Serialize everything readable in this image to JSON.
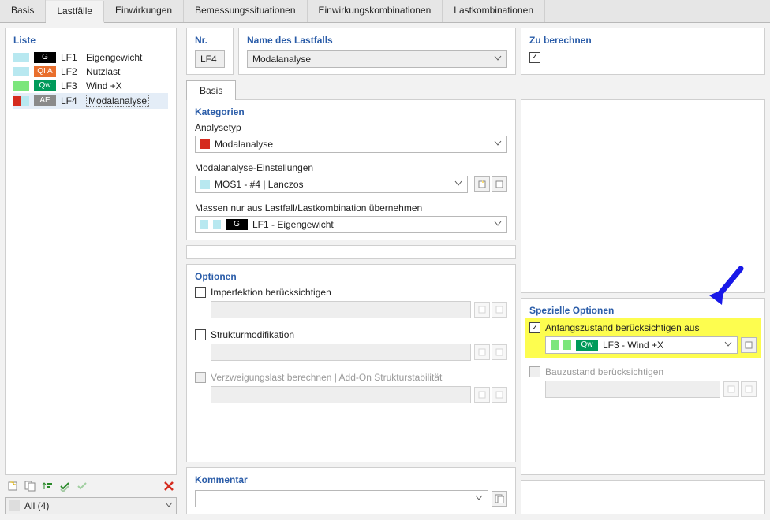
{
  "topTabs": {
    "items": [
      "Basis",
      "Lastfälle",
      "Einwirkungen",
      "Bemessungssituationen",
      "Einwirkungskombinationen",
      "Lastkombinationen"
    ],
    "activeIndex": 1
  },
  "left": {
    "title": "Liste",
    "rows": [
      {
        "swatches": [
          "#b8e8f0",
          "#b8e8f0"
        ],
        "badge": {
          "bg": "#000",
          "txt": "G"
        },
        "id": "LF1",
        "name": "Eigengewicht"
      },
      {
        "swatches": [
          "#b8e8f0",
          "#b8e8f0"
        ],
        "badge": {
          "bg": "#e96f2d",
          "txt": "QI A"
        },
        "id": "LF2",
        "name": "Nutzlast"
      },
      {
        "swatches": [
          "#7ce67c",
          "#7ce67c"
        ],
        "badge": {
          "bg": "#009a5a",
          "txt": "Qw"
        },
        "id": "LF3",
        "name": "Wind +X"
      },
      {
        "swatches": [
          "#d52b1e",
          "#b8e8f0"
        ],
        "badge": {
          "bg": "#8a8a8a",
          "txt": "AE"
        },
        "id": "LF4",
        "name": "Modalanalyse",
        "selected": true
      }
    ],
    "filter": "All (4)"
  },
  "hdr": {
    "nrTitle": "Nr.",
    "nrValue": "LF4",
    "nameTitle": "Name des Lastfalls",
    "nameValue": "Modalanalyse",
    "calcTitle": "Zu berechnen"
  },
  "innerTab": "Basis",
  "kategorien": {
    "title": "Kategorien",
    "analyseLabel": "Analysetyp",
    "analyseValue": "Modalanalyse",
    "settingsLabel": "Modalanalyse-Einstellungen",
    "settingsValue": "MOS1 - #4 | Lanczos",
    "massLabel": "Massen nur aus Lastfall/Lastkombination übernehmen",
    "massBadge": "G",
    "massValue": "LF1 - Eigengewicht"
  },
  "optionen": {
    "title": "Optionen",
    "imperf": "Imperfektion berücksichtigen",
    "struct": "Strukturmodifikation",
    "buck": "Verzweigungslast berechnen | Add-On Strukturstabilität"
  },
  "spezielle": {
    "title": "Spezielle Optionen",
    "initial": "Anfangszustand berücksichtigen aus",
    "initialBadge": "Qw",
    "initialValue": "LF3 - Wind +X",
    "constr": "Bauzustand berücksichtigen"
  },
  "kommentar": {
    "title": "Kommentar"
  }
}
